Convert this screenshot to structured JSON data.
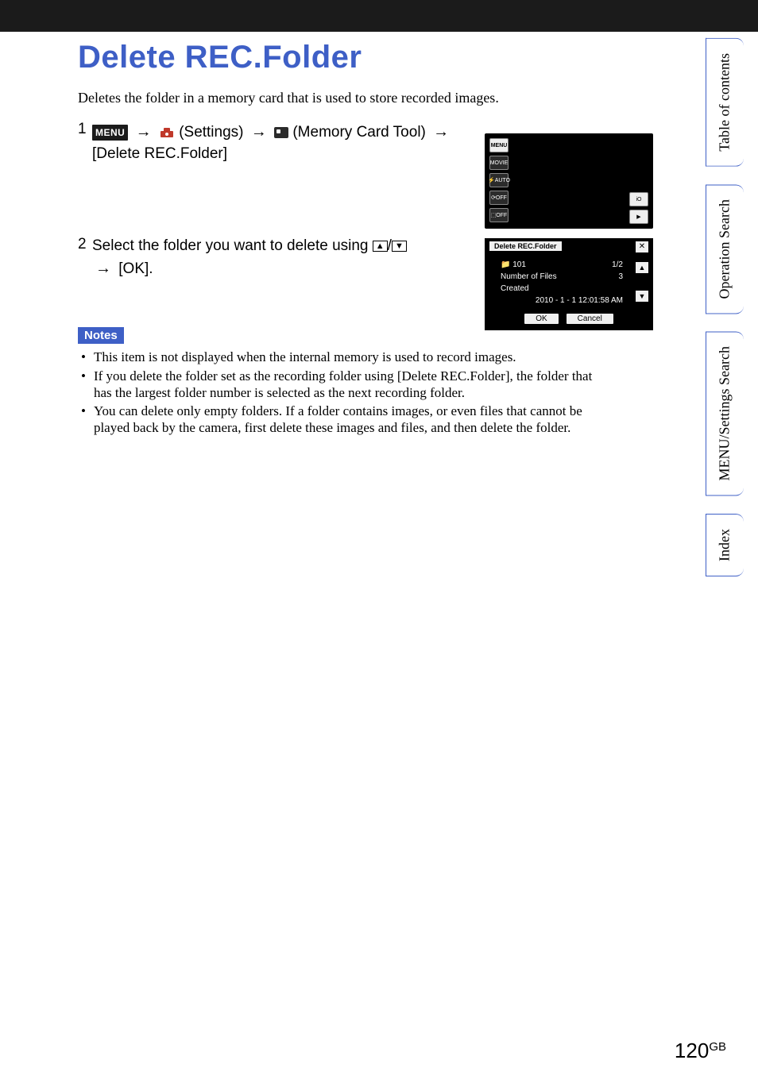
{
  "page_title": "Delete REC.Folder",
  "intro": "Deletes the folder in a memory card that is used to store recorded images.",
  "steps": [
    {
      "num": "1",
      "menu_label": "MENU",
      "settings_label": "(Settings)",
      "tool_label": "(Memory Card Tool)",
      "target": "[Delete REC.Folder]"
    },
    {
      "num": "2",
      "prefix": "Select the folder you want to delete using ",
      "suffix": " [OK]."
    }
  ],
  "notes_label": "Notes",
  "notes": [
    "This item is not displayed when the internal memory is used to record images.",
    "If you delete the folder set as the recording folder using [Delete REC.Folder], the folder that has the largest folder number is selected as the next recording folder.",
    "You can delete only empty folders. If a folder contains images, or even files that cannot be played back by the camera, first delete these images and files, and then delete the folder."
  ],
  "side_tabs": [
    "Table of contents",
    "Operation Search",
    "MENU/Settings Search",
    "Index"
  ],
  "cam1_icons": [
    "MENU",
    "MOVIE",
    "⚡AUTO",
    "⟳OFF",
    "⬚OFF"
  ],
  "cam1_right_icons": [
    "iO",
    "▶"
  ],
  "cam2": {
    "title": "Delete REC.Folder",
    "folder": "101",
    "page": "1/2",
    "files_label": "Number of Files",
    "files_value": "3",
    "created_label": "Created",
    "created_value": "2010 - 1 - 1  12:01:58 AM",
    "ok": "OK",
    "cancel": "Cancel"
  },
  "footer": {
    "page": "120",
    "region": "GB"
  }
}
